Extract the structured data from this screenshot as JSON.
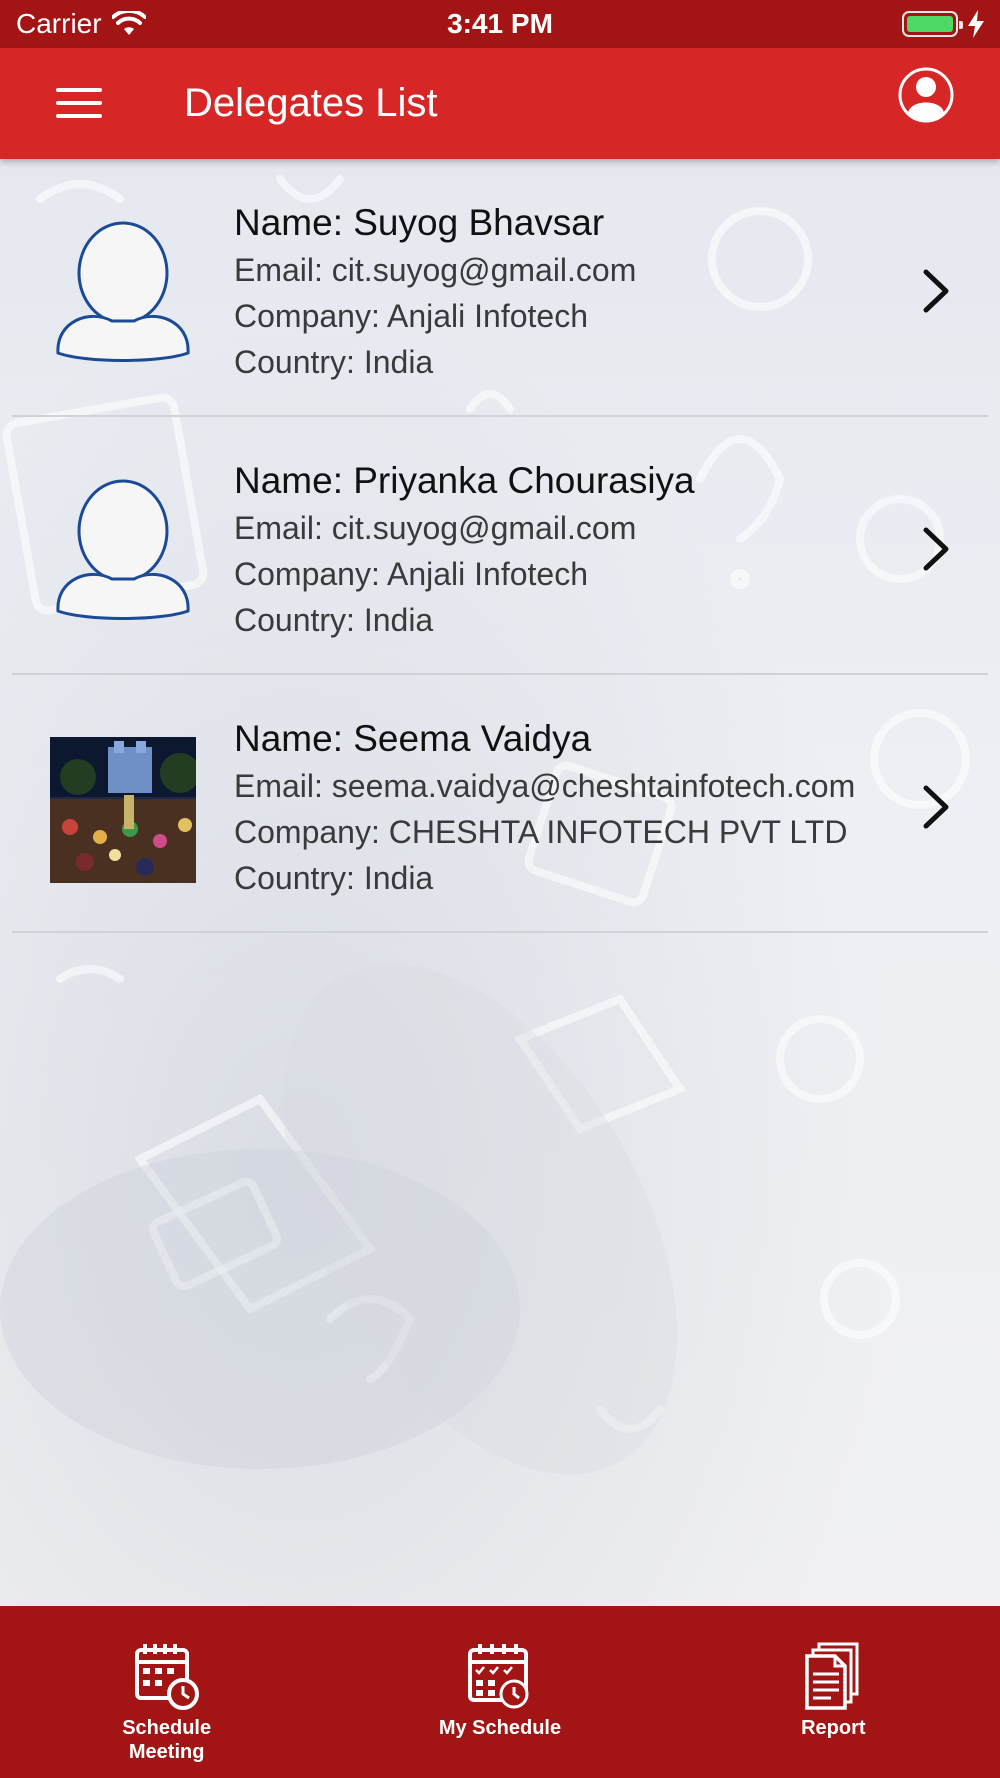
{
  "status_bar": {
    "carrier": "Carrier",
    "time": "3:41 PM"
  },
  "nav": {
    "title": "Delegates List",
    "menu_icon": "hamburger-menu-icon",
    "profile_icon": "user-profile-icon"
  },
  "delegates": [
    {
      "name": "Name: Suyog Bhavsar",
      "email": "Email: cit.suyog@gmail.com",
      "company": "Company: Anjali Infotech",
      "country": "Country: India",
      "avatar": "placeholder-avatar"
    },
    {
      "name": "Name: Priyanka Chourasiya",
      "email": "Email: cit.suyog@gmail.com",
      "company": "Company: Anjali Infotech",
      "country": "Country: India",
      "avatar": "placeholder-avatar"
    },
    {
      "name": "Name: Seema Vaidya",
      "email": "Email: seema.vaidya@cheshtainfotech.com",
      "company": "Company: CHESHTA INFOTECH PVT LTD",
      "country": "Country: India",
      "avatar": "photo"
    }
  ],
  "tab_bar": {
    "tabs": [
      {
        "label_line1": "Schedule",
        "label_line2": "Meeting",
        "icon": "calendar-clock-icon"
      },
      {
        "label_line1": "My Schedule",
        "label_line2": "",
        "icon": "calendar-check-icon"
      },
      {
        "label_line1": "Report",
        "label_line2": "",
        "icon": "report-document-icon"
      }
    ]
  },
  "colors": {
    "status_bar": "#a31515",
    "nav_bar": "#d72626",
    "tab_bar": "#a31515",
    "battery": "#4cd964"
  }
}
